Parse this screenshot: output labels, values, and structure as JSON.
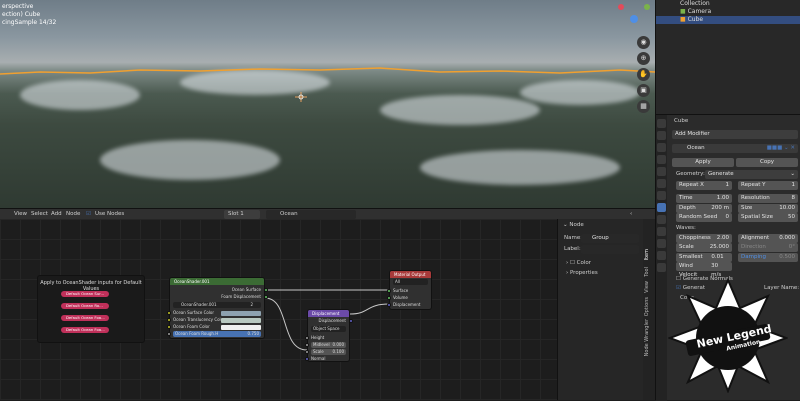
{
  "viewport": {
    "lines": [
      "erspective",
      "ection) Cube",
      "cingSample 14/32"
    ]
  },
  "outliner": {
    "rows": [
      "Collection",
      "Camera",
      "Cube"
    ]
  },
  "properties": {
    "object_name": "Cube",
    "add_modifier": "Add Modifier",
    "modifier_name": "Ocean",
    "apply": "Apply",
    "copy": "Copy",
    "geometry_label": "Geometry:",
    "geometry_value": "Generate",
    "repeat_x": {
      "label": "Repeat X",
      "value": "1"
    },
    "repeat_y": {
      "label": "Repeat Y",
      "value": "1"
    },
    "time": {
      "label": "Time",
      "value": "1.00"
    },
    "resolution": {
      "label": "Resolution",
      "value": "8"
    },
    "depth": {
      "label": "Depth",
      "value": "200 m"
    },
    "size": {
      "label": "Size",
      "value": "10.00"
    },
    "random_seed": {
      "label": "Random Seed",
      "value": "0"
    },
    "spatial_size": {
      "label": "Spatial Size",
      "value": "50"
    },
    "waves_label": "Waves:",
    "choppiness": {
      "label": "Choppiness",
      "value": "2.00"
    },
    "alignment": {
      "label": "Alignment",
      "value": "0.000"
    },
    "scale": {
      "label": "Scale",
      "value": "25.000"
    },
    "direction": {
      "label": "Direction",
      "value": "0°"
    },
    "smallest": {
      "label": "Smallest W...",
      "value": "0.01 m"
    },
    "damping": {
      "label": "Damping",
      "value": "0.500"
    },
    "wind_velocity": {
      "label": "Wind Velocit",
      "value": "30 m/s"
    },
    "generate_normals": "Generate Normals",
    "generate": "Generat",
    "layer_name": "Layer Name:",
    "cov": "Cove"
  },
  "node_header": {
    "view": "View",
    "select": "Select",
    "add": "Add",
    "node": "Node",
    "use_nodes": "Use Nodes",
    "slot": "Slot 1",
    "material": "Ocean"
  },
  "frame_node": {
    "title": "Apply to OceanShader inputs for Default Values",
    "buttons": [
      "Default Ocean Sur...",
      "Default Ocean Ro...",
      "Default Ocean Foa...",
      "Default Ocean Foa..."
    ]
  },
  "ocean_node": {
    "title": "OceanShader.001",
    "out_surface": "Ocean Surface",
    "out_disp": "Foam Displacement",
    "group_name": "OceanShader.001",
    "group_users": "2",
    "in_color": "Ocean Surface Color",
    "in_trans": "Ocean Translucency Color",
    "in_foam": "Ocean Foam Color",
    "in_rough": "Ocean Foam Rough.H",
    "rough_val": "0.750"
  },
  "disp_node": {
    "title": "Displacement",
    "out": "Displacement",
    "space": "Object Space",
    "height": "Height",
    "midlevel_label": "Midlevel",
    "midlevel": "0.000",
    "scale_label": "Scale",
    "scale": "0.100",
    "normal": "Normal"
  },
  "output_node": {
    "title": "Material Output",
    "target": "All",
    "surface": "Surface",
    "volume": "Volume",
    "displacement": "Displacement"
  },
  "sidebar": {
    "section": "Node",
    "name_label": "Name:",
    "name_value": "Group",
    "label_label": "Label:",
    "color": "Color",
    "properties": "Properties"
  },
  "sidetabs": [
    "Item",
    "Tool",
    "View",
    "Options",
    "Node Wrangler"
  ],
  "logo": {
    "line1": "New Legend",
    "line2": "Animation"
  },
  "colors": {
    "accent": "#4772b3",
    "orange": "#f0a030"
  }
}
